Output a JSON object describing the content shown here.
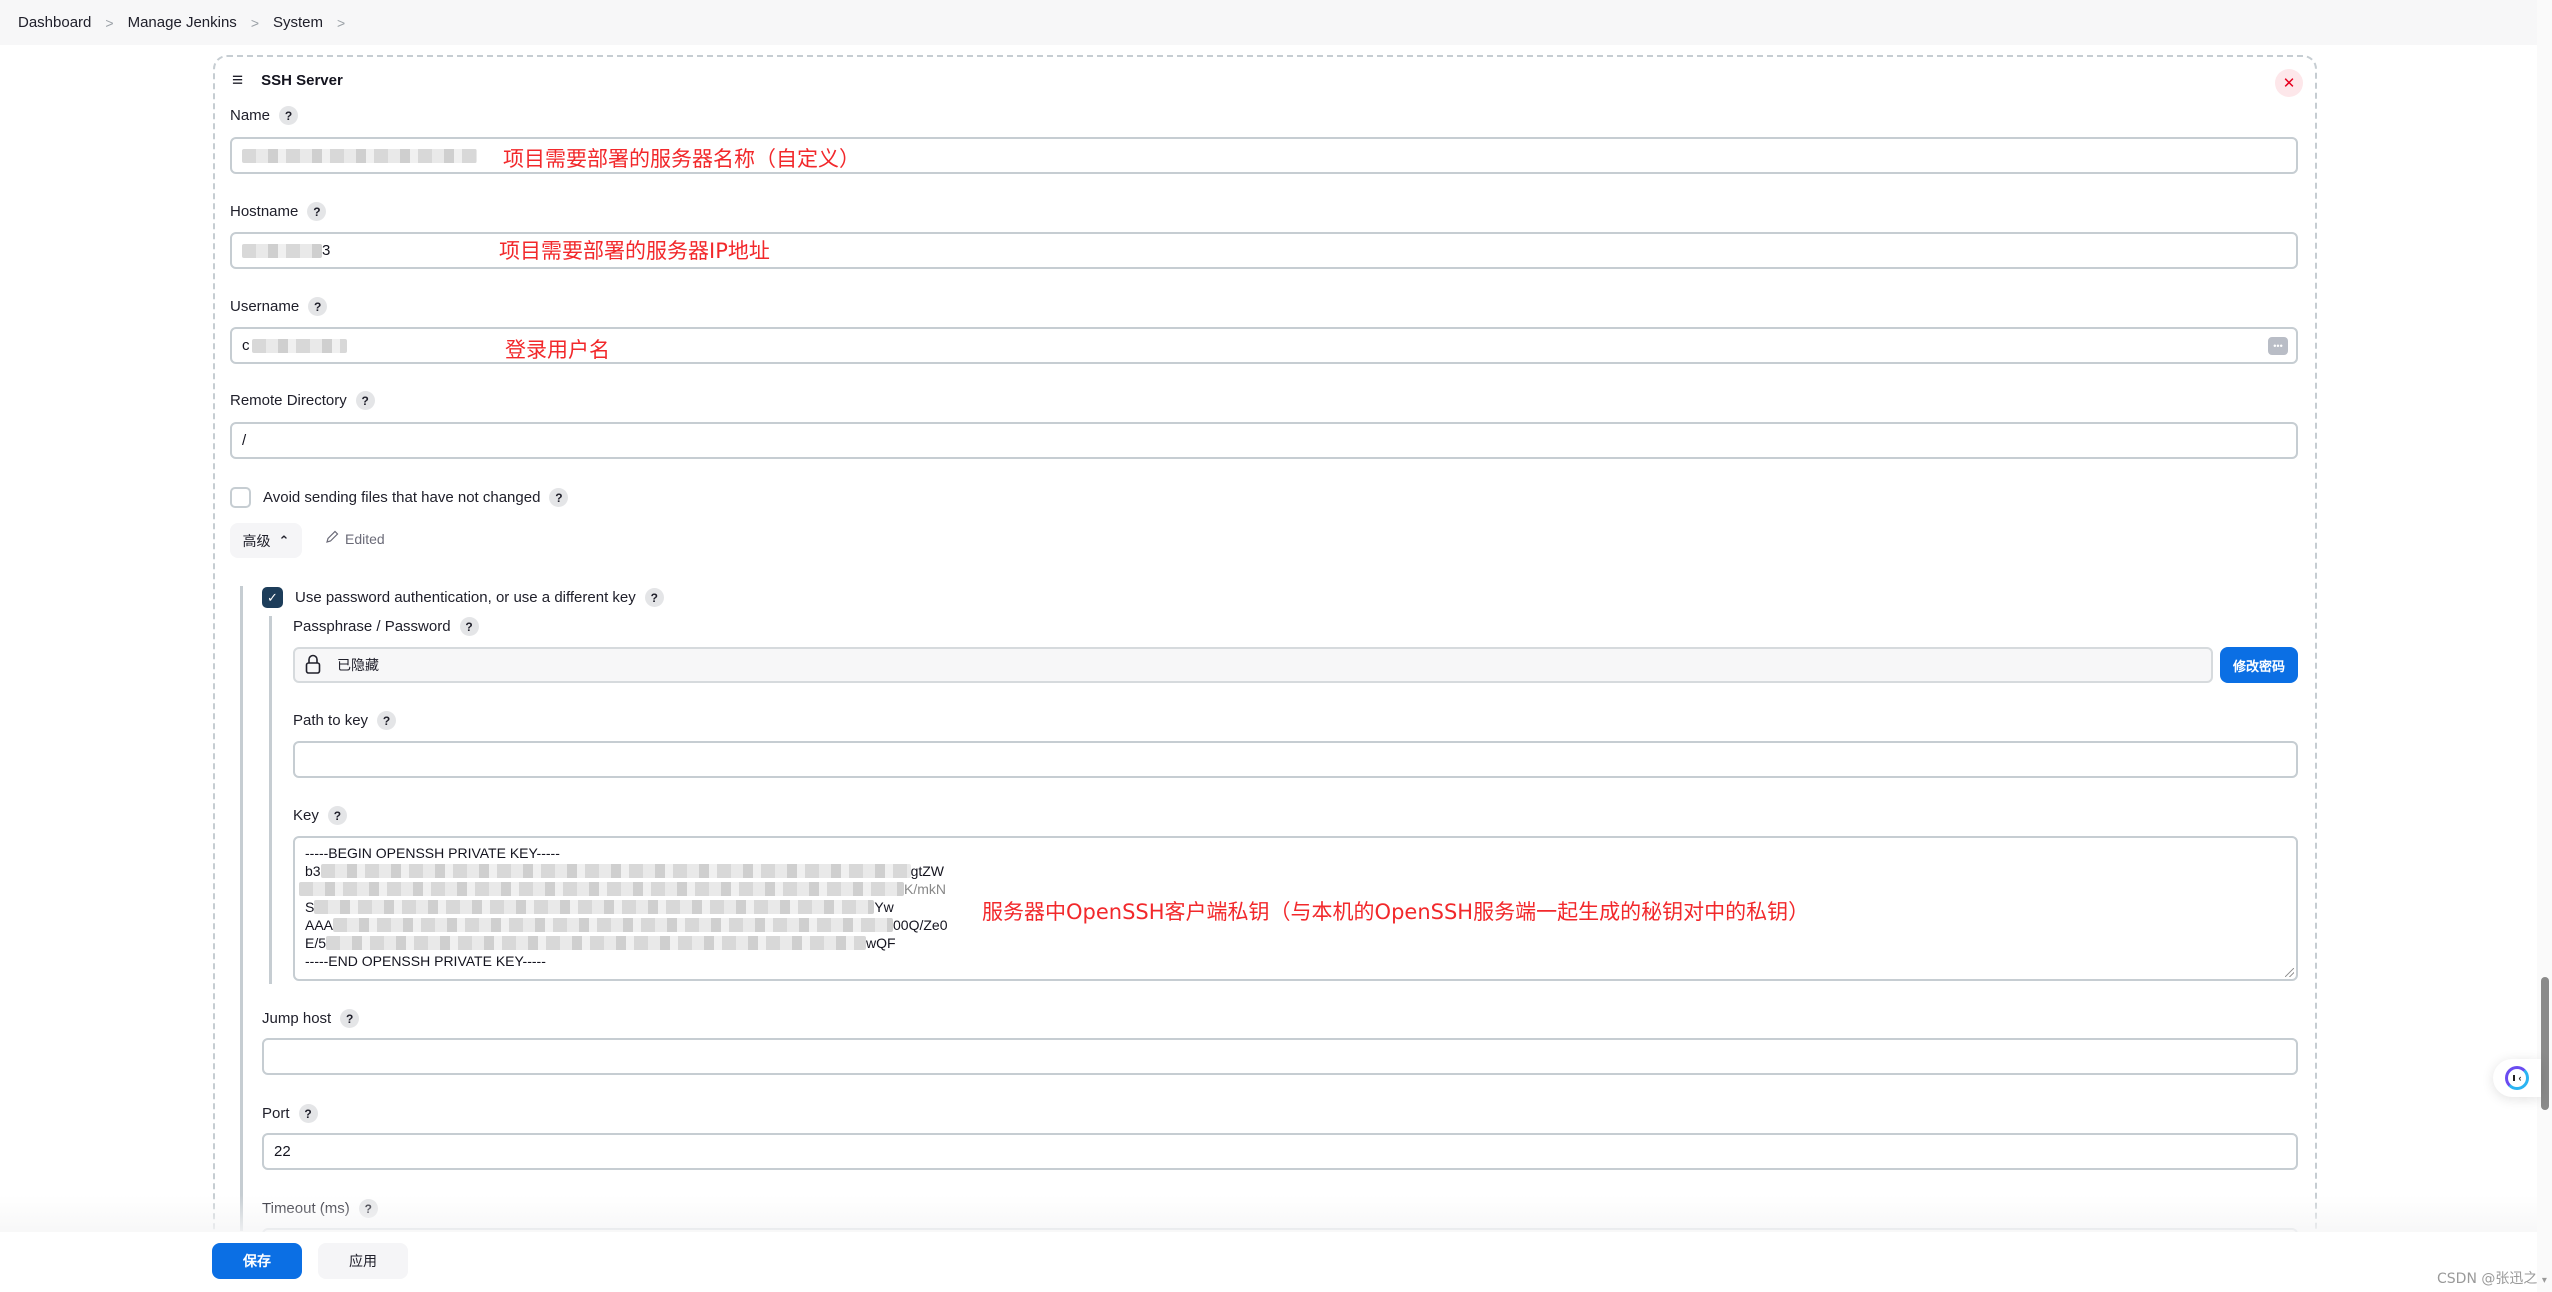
{
  "breadcrumb": {
    "items": [
      "Dashboard",
      "Manage Jenkins",
      "System"
    ],
    "separator": ">"
  },
  "card": {
    "title": "SSH Server",
    "drag_icon": "≡",
    "close_icon": "✕"
  },
  "help_icon": "?",
  "fields": {
    "name": {
      "label": "Name",
      "value_visible_prefix": "",
      "annotation": "项目需要部署的服务器名称（自定义）"
    },
    "hostname": {
      "label": "Hostname",
      "value_visible_suffix": "3",
      "annotation": "项目需要部署的服务器IP地址"
    },
    "username": {
      "label": "Username",
      "value_visible_prefix": "c",
      "annotation": "登录用户名",
      "password_manager_icon": "•••"
    },
    "remote_directory": {
      "label": "Remote Directory",
      "value": "/"
    },
    "avoid_sending": {
      "label": "Avoid sending files that have not changed",
      "checked": false
    },
    "advanced": {
      "label": "高级",
      "chevron": "⌃",
      "edited_label": "Edited"
    },
    "use_password": {
      "label": "Use password authentication, or use a different key",
      "checked": true,
      "check_mark": "✓"
    },
    "passphrase": {
      "label": "Passphrase / Password",
      "value": "已隐藏",
      "change_button": "修改密码"
    },
    "path_to_key": {
      "label": "Path to key",
      "value": ""
    },
    "key": {
      "label": "Key",
      "lines": [
        {
          "start": "-----BEGIN OPENSSH PRIVATE KEY-----",
          "end": "",
          "redacted": false
        },
        {
          "start": "b3",
          "end": "gtZW",
          "redacted": true
        },
        {
          "start": "",
          "end": "K/mkN",
          "redacted": true
        },
        {
          "start": "S",
          "end": "Yw",
          "redacted": true
        },
        {
          "start": "AAA",
          "end": "00Q/Ze0",
          "redacted": true
        },
        {
          "start": "E/5",
          "end": "wQF",
          "redacted": true
        },
        {
          "start": "-----END OPENSSH PRIVATE KEY-----",
          "end": "",
          "redacted": false
        }
      ],
      "annotation": "服务器中OpenSSH客户端私钥（与本机的OpenSSH服务端一起生成的秘钥对中的私钥）"
    },
    "jump_host": {
      "label": "Jump host",
      "value": ""
    },
    "port": {
      "label": "Port",
      "value": "22"
    },
    "timeout": {
      "label": "Timeout (ms)"
    }
  },
  "footer": {
    "save": "保存",
    "apply": "应用"
  },
  "watermark": "CSDN @张迅之",
  "colors": {
    "primary": "#0b6fe4",
    "annotation": "#f2282b",
    "checkbox_checked": "#1d3d5a",
    "close": "#e6001f"
  }
}
